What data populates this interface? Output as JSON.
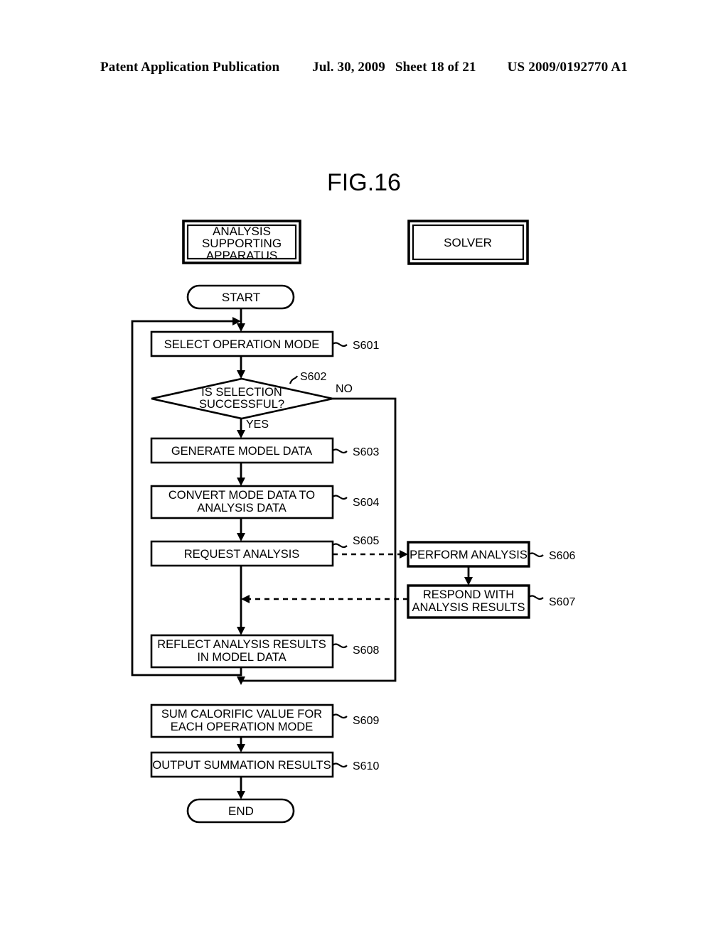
{
  "header": {
    "publication": "Patent Application Publication",
    "date": "Jul. 30, 2009",
    "sheet": "Sheet 18 of 21",
    "patent_number": "US 2009/0192770 A1"
  },
  "figure": {
    "title": "FIG.16",
    "type": "flowchart",
    "lanes": [
      {
        "id": "lane-apparatus",
        "label": "ANALYSIS\nSUPPORTING\nAPPARATUS",
        "line1": "ANALYSIS",
        "line2": "SUPPORTING",
        "line3": "APPARATUS"
      },
      {
        "id": "lane-solver",
        "label": "SOLVER",
        "line1": "SOLVER"
      }
    ],
    "terminals": [
      {
        "id": "start",
        "label": "START"
      },
      {
        "id": "end",
        "label": "END"
      }
    ],
    "steps": [
      {
        "id": "s601",
        "step": "S601",
        "line1": "SELECT OPERATION MODE",
        "lane": "lane-apparatus",
        "shape": "process"
      },
      {
        "id": "s602",
        "step": "S602",
        "line1": "IS SELECTION",
        "line2": "SUCCESSFUL?",
        "lane": "lane-apparatus",
        "shape": "decision"
      },
      {
        "id": "s603",
        "step": "S603",
        "line1": "GENERATE MODEL DATA",
        "lane": "lane-apparatus",
        "shape": "process"
      },
      {
        "id": "s604",
        "step": "S604",
        "line1": "CONVERT MODE DATA TO",
        "line2": "ANALYSIS DATA",
        "lane": "lane-apparatus",
        "shape": "process"
      },
      {
        "id": "s605",
        "step": "S605",
        "line1": "REQUEST ANALYSIS",
        "lane": "lane-apparatus",
        "shape": "process"
      },
      {
        "id": "s606",
        "step": "S606",
        "line1": "PERFORM ANALYSIS",
        "lane": "lane-solver",
        "shape": "process"
      },
      {
        "id": "s607",
        "step": "S607",
        "line1": "RESPOND WITH",
        "line2": "ANALYSIS RESULTS",
        "lane": "lane-solver",
        "shape": "process"
      },
      {
        "id": "s608",
        "step": "S608",
        "line1": "REFLECT ANALYSIS RESULTS",
        "line2": "IN MODEL DATA",
        "lane": "lane-apparatus",
        "shape": "process"
      },
      {
        "id": "s609",
        "step": "S609",
        "line1": "SUM CALORIFIC VALUE FOR",
        "line2": "EACH OPERATION MODE",
        "lane": "lane-apparatus",
        "shape": "process"
      },
      {
        "id": "s610",
        "step": "S610",
        "line1": "OUTPUT SUMMATION RESULTS",
        "lane": "lane-apparatus",
        "shape": "process"
      }
    ],
    "branches": [
      {
        "id": "branch-no",
        "label": "NO",
        "from": "s602"
      },
      {
        "id": "branch-yes",
        "label": "YES",
        "from": "s602"
      }
    ]
  }
}
